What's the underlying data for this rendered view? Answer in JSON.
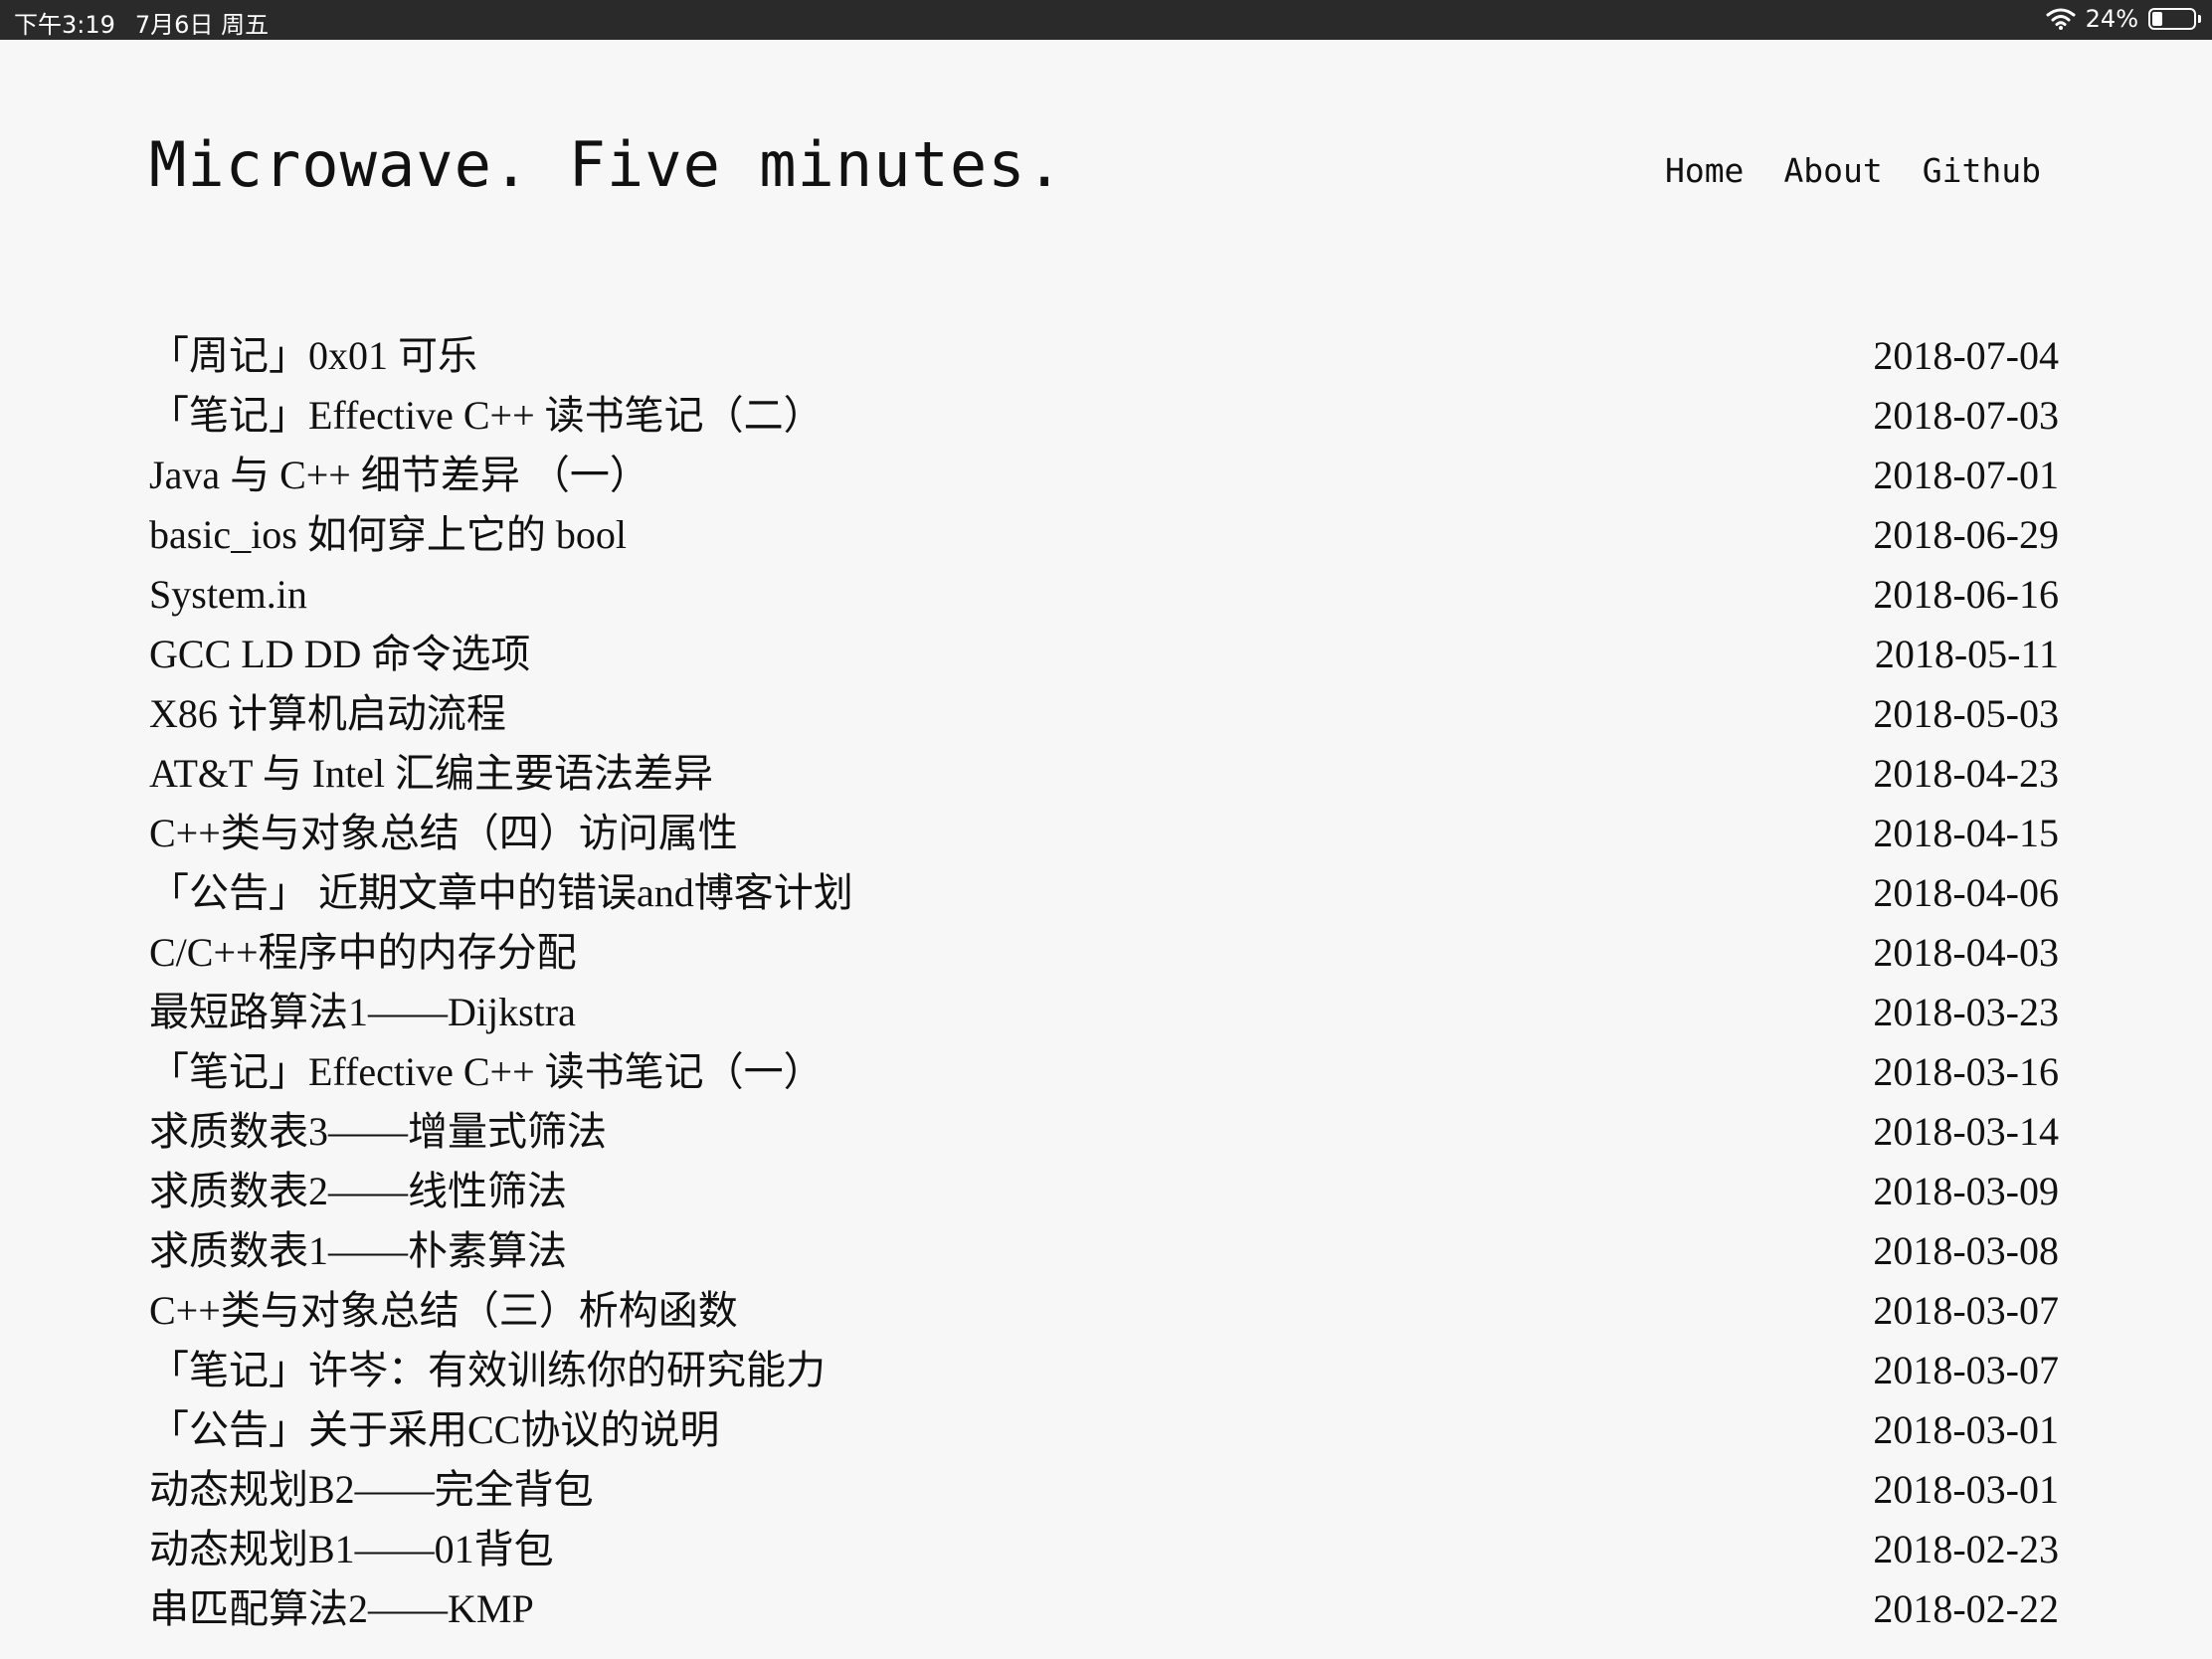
{
  "status_bar": {
    "time": "下午3:19",
    "date": "7月6日 周五",
    "battery_percent_label": "24%",
    "battery_level": 0.24,
    "wifi_icon": "wifi-icon",
    "battery_icon": "battery-icon"
  },
  "site": {
    "title": "Microwave. Five minutes."
  },
  "nav": {
    "items": [
      {
        "label": "Home"
      },
      {
        "label": "About"
      },
      {
        "label": "Github"
      }
    ]
  },
  "posts": [
    {
      "title": "「周记」0x01 可乐",
      "date": "2018-07-04"
    },
    {
      "title": "「笔记」Effective C++ 读书笔记（二）",
      "date": "2018-07-03"
    },
    {
      "title": "Java 与 C++ 细节差异 （一）",
      "date": "2018-07-01"
    },
    {
      "title": "basic_ios 如何穿上它的 bool",
      "date": "2018-06-29"
    },
    {
      "title": "System.in",
      "date": "2018-06-16"
    },
    {
      "title": "GCC LD DD 命令选项",
      "date": "2018-05-11"
    },
    {
      "title": "X86 计算机启动流程",
      "date": "2018-05-03"
    },
    {
      "title": "AT&T 与 Intel 汇编主要语法差异",
      "date": "2018-04-23"
    },
    {
      "title": "C++类与对象总结（四）访问属性",
      "date": "2018-04-15"
    },
    {
      "title": "「公告」 近期文章中的错误and博客计划",
      "date": "2018-04-06"
    },
    {
      "title": "C/C++程序中的内存分配",
      "date": "2018-04-03"
    },
    {
      "title": "最短路算法1——Dijkstra",
      "date": "2018-03-23"
    },
    {
      "title": "「笔记」Effective C++ 读书笔记（一）",
      "date": "2018-03-16"
    },
    {
      "title": "求质数表3——增量式筛法",
      "date": "2018-03-14"
    },
    {
      "title": "求质数表2——线性筛法",
      "date": "2018-03-09"
    },
    {
      "title": "求质数表1——朴素算法",
      "date": "2018-03-08"
    },
    {
      "title": "C++类与对象总结（三）析构函数",
      "date": "2018-03-07"
    },
    {
      "title": "「笔记」许岑：有效训练你的研究能力",
      "date": "2018-03-07"
    },
    {
      "title": "「公告」关于采用CC协议的说明",
      "date": "2018-03-01"
    },
    {
      "title": "动态规划B2——完全背包",
      "date": "2018-03-01"
    },
    {
      "title": "动态规划B1——01背包",
      "date": "2018-02-23"
    },
    {
      "title": "串匹配算法2——KMP",
      "date": "2018-02-22"
    }
  ]
}
